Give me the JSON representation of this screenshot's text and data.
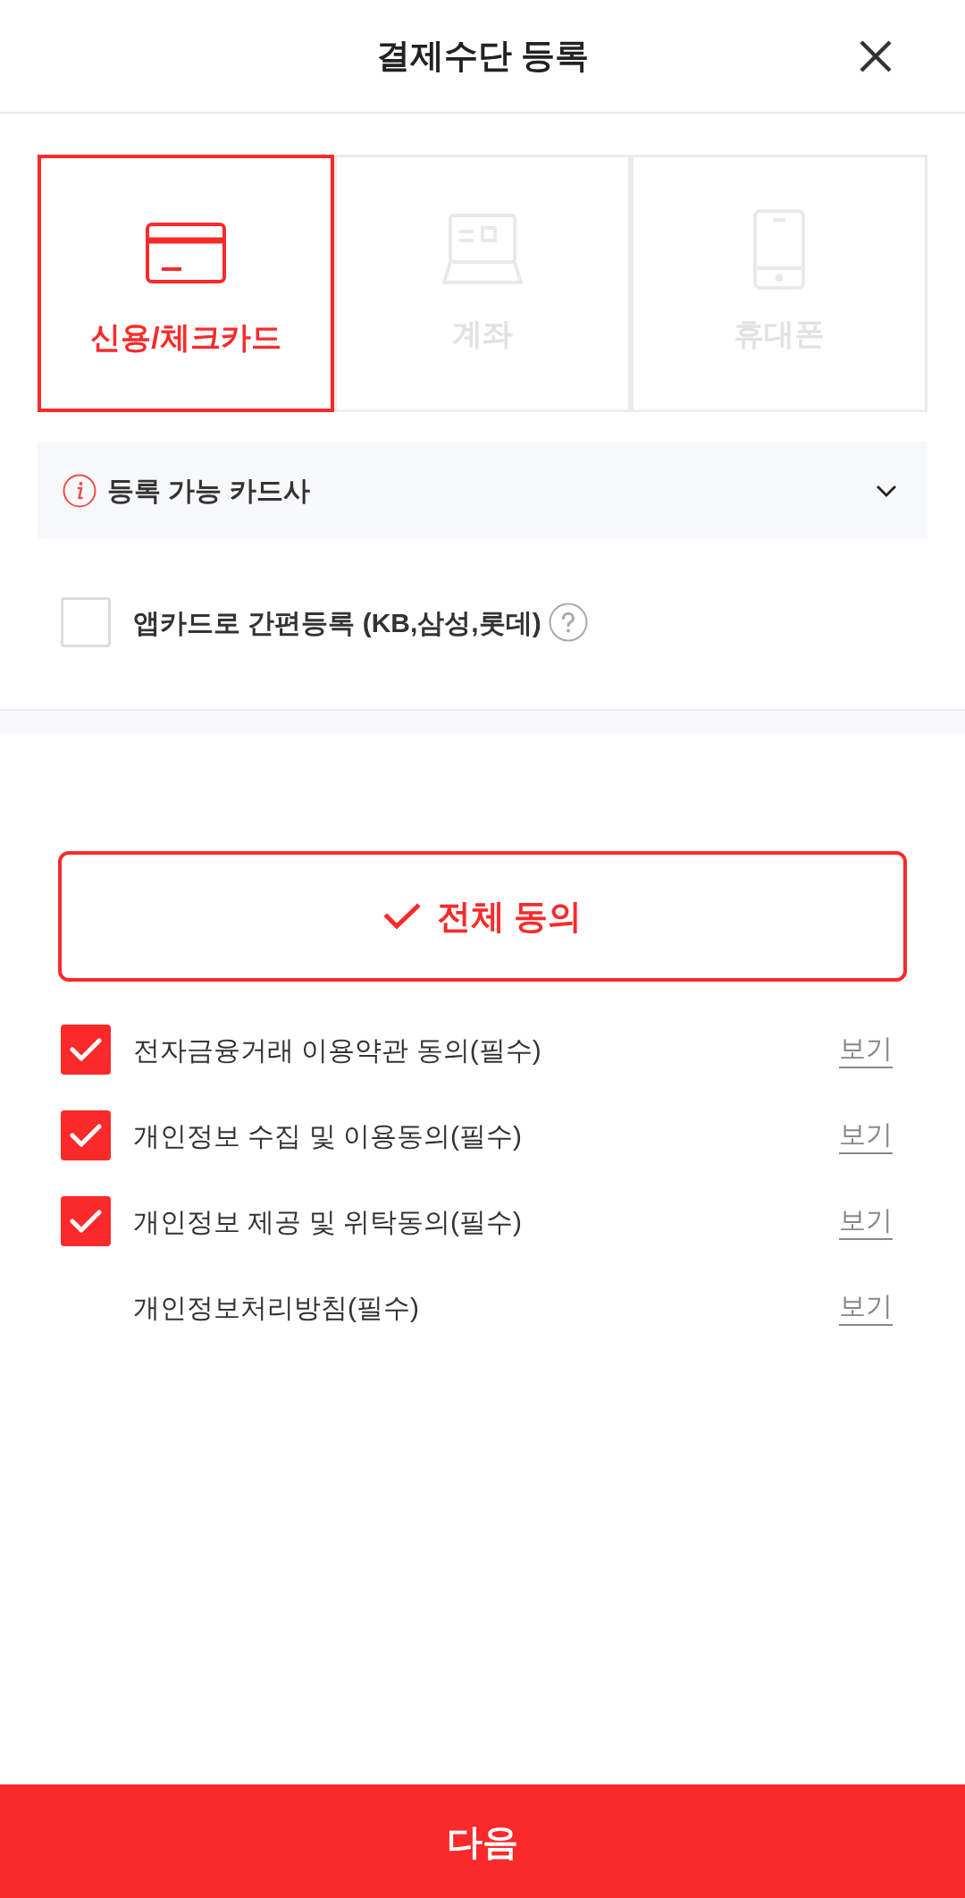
{
  "header": {
    "title": "결제수단 등록"
  },
  "payment_methods": [
    {
      "kind": "card",
      "label": "신용/체크카드",
      "selected": true
    },
    {
      "kind": "account",
      "label": "계좌",
      "selected": false
    },
    {
      "kind": "phone",
      "label": "휴대폰",
      "selected": false
    }
  ],
  "card_issuers": {
    "label": "등록 가능 카드사",
    "expanded": false
  },
  "app_card": {
    "label": "앱카드로 간편등록 (KB,삼성,롯데)",
    "checked": false
  },
  "agree_all": {
    "label": "전체 동의"
  },
  "agreements": [
    {
      "kind": "checkbox",
      "label": "전자금융거래 이용약관 동의(필수)",
      "checked": true,
      "link": "보기"
    },
    {
      "kind": "checkbox",
      "label": "개인정보 수집 및 이용동의(필수)",
      "checked": true,
      "link": "보기"
    },
    {
      "kind": "checkbox",
      "label": "개인정보 제공 및 위탁동의(필수)",
      "checked": true,
      "link": "보기"
    },
    {
      "kind": "plain",
      "label": "개인정보처리방침(필수)",
      "link": "보기"
    }
  ],
  "next_button": {
    "label": "다음"
  }
}
